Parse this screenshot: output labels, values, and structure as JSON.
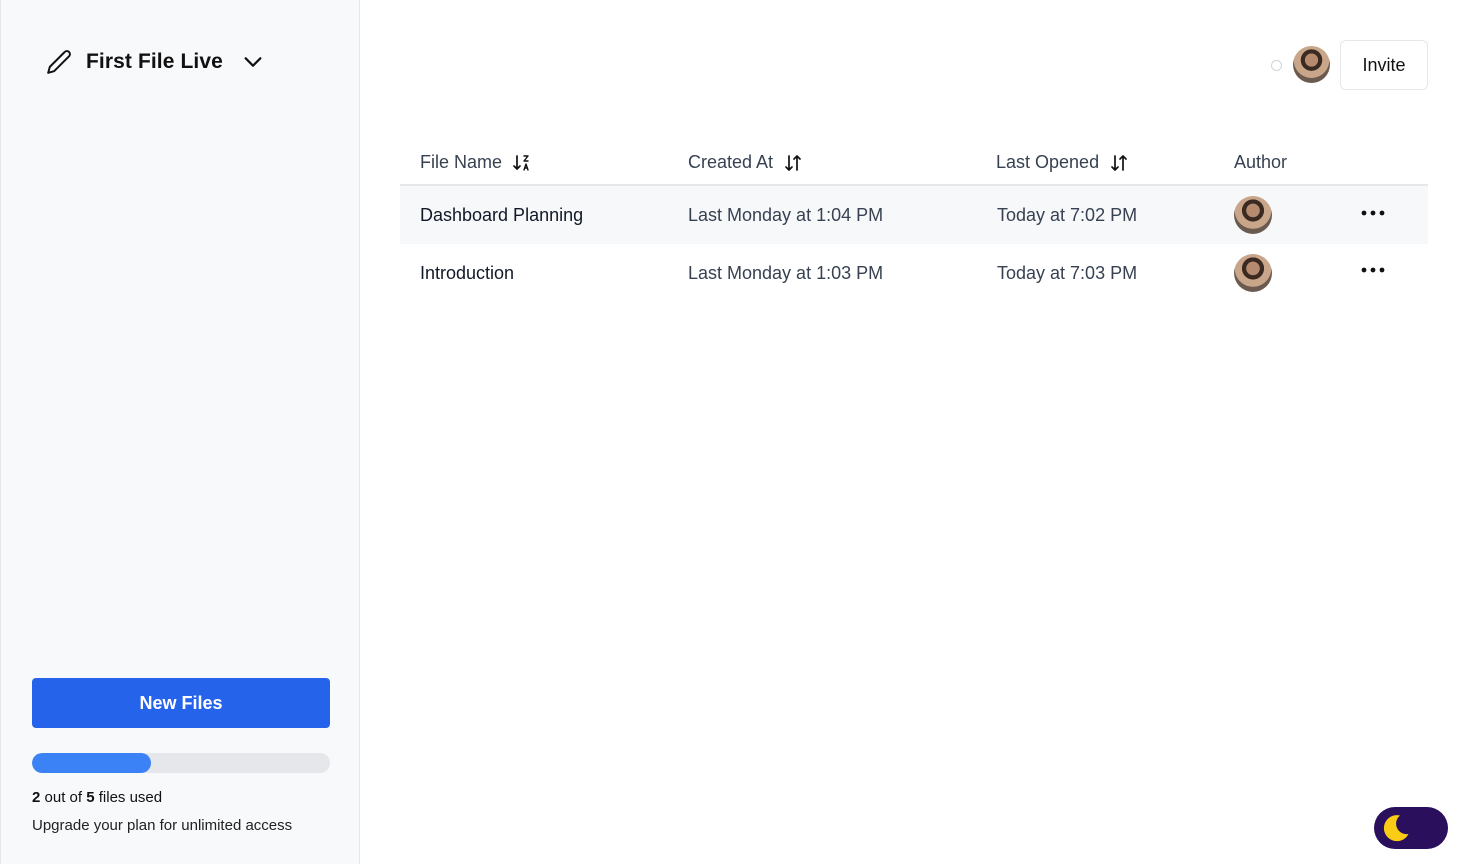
{
  "workspace": {
    "title": "First File Live",
    "edit_icon": "pencil-icon",
    "dropdown_icon": "chevron-down-icon"
  },
  "sidebar": {
    "new_files_label": "New Files",
    "usage": {
      "used": "2",
      "out_of_text": " out of ",
      "total": "5",
      "suffix": " files used",
      "fraction": 0.4
    },
    "upgrade_text": "Upgrade your plan for unlimited access"
  },
  "header": {
    "invite_label": "Invite",
    "presence_icon": "status-dot-icon",
    "avatar_icon": "user-avatar"
  },
  "table": {
    "columns": [
      {
        "label": "File Name",
        "sort_icon": "sort-alpha-down-icon"
      },
      {
        "label": "Created At",
        "sort_icon": "sort-arrows-icon"
      },
      {
        "label": "Last Opened",
        "sort_icon": "sort-arrows-icon"
      },
      {
        "label": "Author"
      }
    ],
    "rows": [
      {
        "name": "Dashboard Planning",
        "created": "Last Monday at 1:04 PM",
        "opened": "Today at 7:02 PM",
        "author_icon": "user-avatar",
        "menu_icon": "more-horizontal-icon"
      },
      {
        "name": "Introduction",
        "created": "Last Monday at 1:03 PM",
        "opened": "Today at 7:03 PM",
        "author_icon": "user-avatar",
        "menu_icon": "more-horizontal-icon"
      }
    ]
  },
  "theme_toggle": {
    "icon": "moon-icon",
    "mode": "dark"
  },
  "colors": {
    "primary": "#2563eb",
    "progress": "#3b82f6",
    "toggle_bg": "#2a0f5c",
    "moon": "#facc15"
  }
}
